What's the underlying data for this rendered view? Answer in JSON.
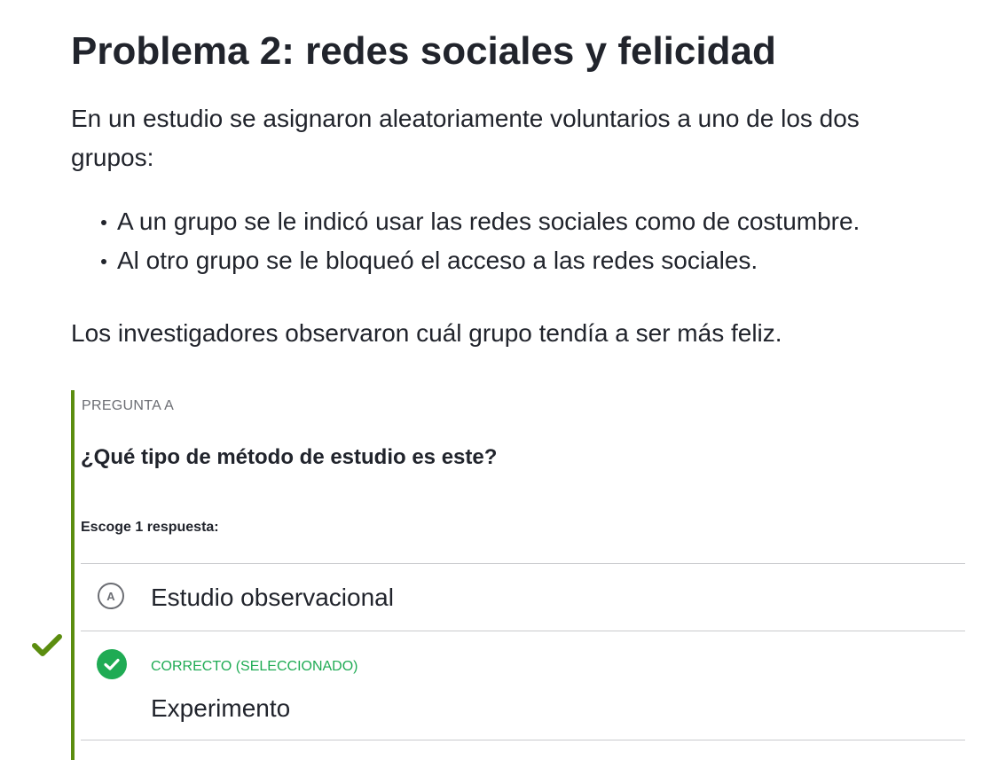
{
  "problem": {
    "title": "Problema 2: redes sociales y felicidad",
    "intro": "En un estudio se asignaron aleatoriamente voluntarios a uno de los dos grupos:",
    "bullets": [
      "A un grupo se le indicó usar las redes sociales como de costumbre.",
      "Al otro grupo se le bloqueó el acceso a las redes sociales."
    ],
    "outro": "Los investigadores observaron cuál grupo tendía a ser más feliz."
  },
  "question": {
    "label": "PREGUNTA A",
    "text": "¿Qué tipo de método de estudio es este?",
    "instructions": "Escoge 1 respuesta:",
    "choices": [
      {
        "letter": "A",
        "text": "Estudio observacional",
        "state": "unselected"
      },
      {
        "status_label": "CORRECTO (SELECCIONADO)",
        "text": "Experimento",
        "state": "correct-selected"
      }
    ]
  },
  "colors": {
    "text": "#21242c",
    "muted": "#6b6d73",
    "bar": "#5b8d0f",
    "correct": "#1fab54",
    "divider": "#c9cacd"
  },
  "icons": {
    "result": "checkmark-icon",
    "correct": "check-circle-icon"
  }
}
